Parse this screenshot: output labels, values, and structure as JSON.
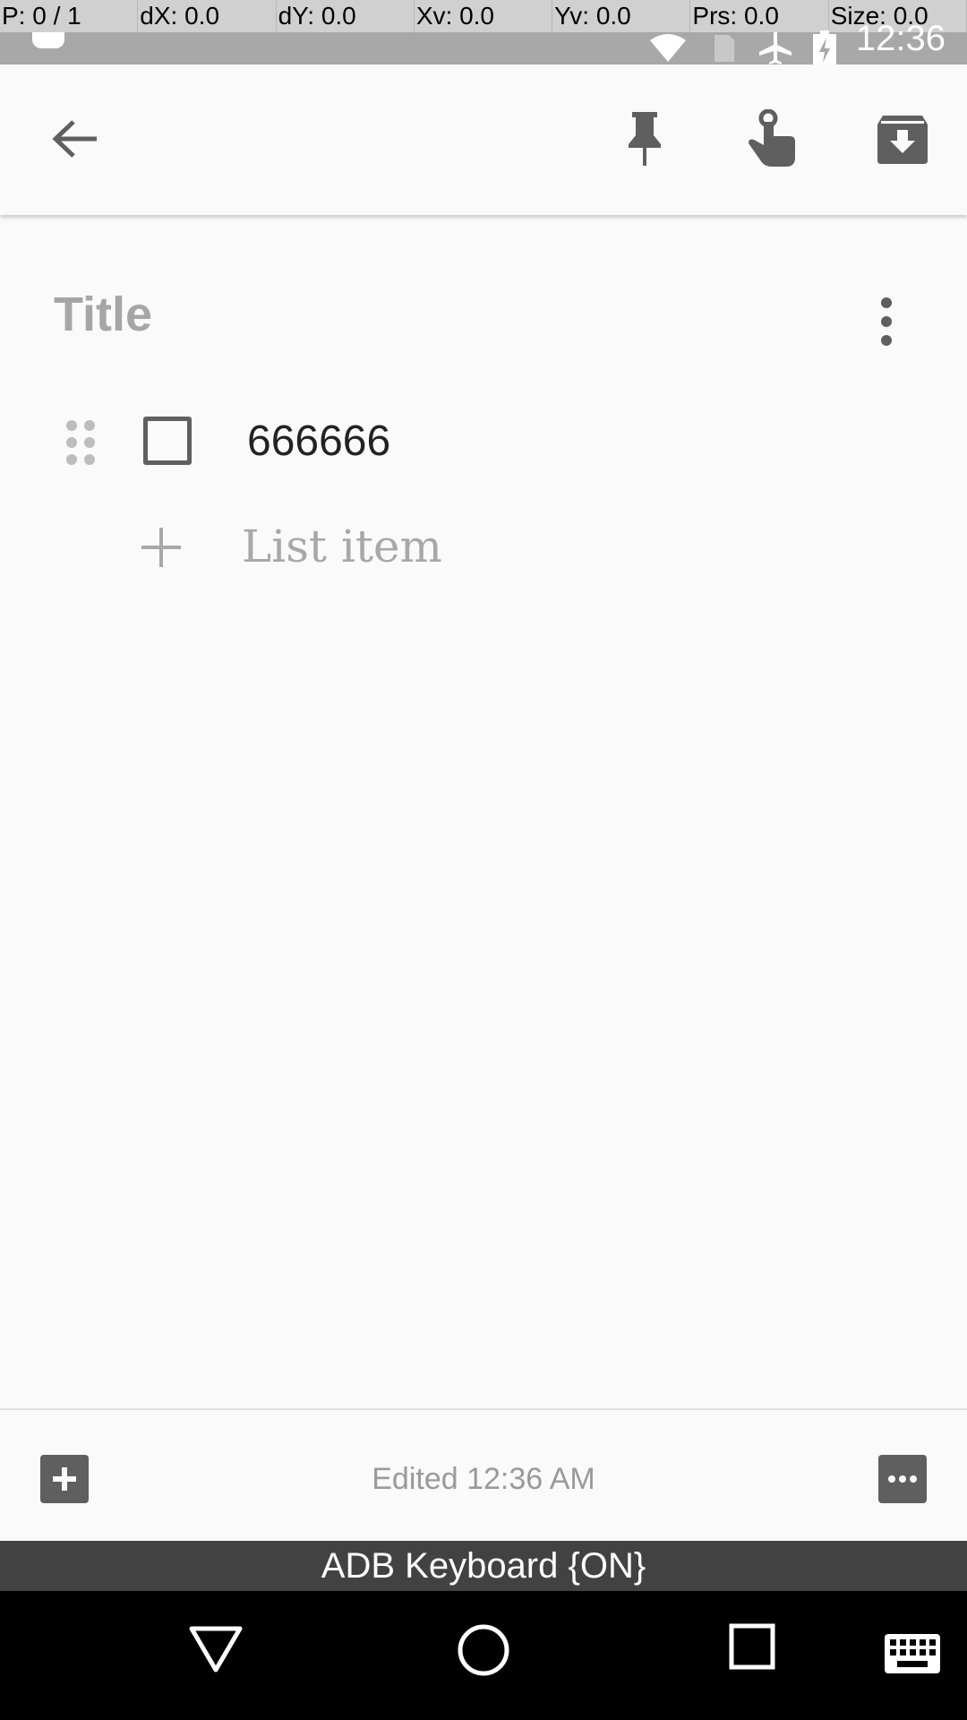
{
  "pointer_info": {
    "p": "P: 0 / 1",
    "dx": "dX: 0.0",
    "dy": "dY: 0.0",
    "xv": "Xv: 0.0",
    "yv": "Yv: 0.0",
    "prs": "Prs: 0.0",
    "size": "Size: 0.0"
  },
  "status": {
    "time": "12:36"
  },
  "toolbar": {
    "back_icon": "arrow-left-icon",
    "pin_icon": "pin-icon",
    "reminder_icon": "reminder-finger-icon",
    "archive_icon": "archive-icon"
  },
  "note": {
    "title_placeholder": "Title",
    "items": [
      {
        "text": "666666",
        "checked": false
      }
    ],
    "add_item_placeholder": "List item"
  },
  "bottom": {
    "edited": "Edited 12:36 AM"
  },
  "keyboard_banner": "ADB Keyboard {ON}",
  "colors": {
    "icon_gray": "#5f5f5f",
    "background": "#fafafa",
    "nav_background": "#000000"
  }
}
